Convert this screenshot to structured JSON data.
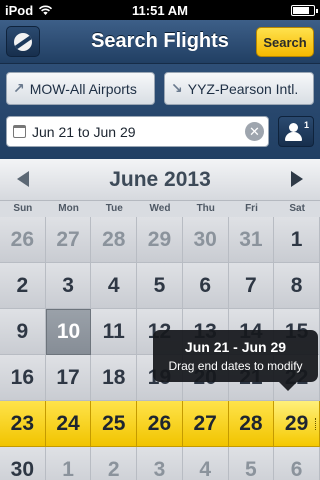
{
  "status_bar": {
    "carrier": "iPod",
    "time": "11:51 AM",
    "battery_level": 0.8
  },
  "header": {
    "title": "Search Flights",
    "search_label": "Search"
  },
  "search": {
    "from": "MOW-All Airports",
    "to": "YYZ-Pearson Intl.",
    "dates": "Jun 21 to Jun 29",
    "passengers": "1"
  },
  "calendar": {
    "month": "June 2013",
    "weekdays": [
      "Sun",
      "Mon",
      "Tue",
      "Wed",
      "Thu",
      "Fri",
      "Sat"
    ],
    "weeks": [
      [
        "26",
        "27",
        "28",
        "29",
        "30",
        "31",
        "1"
      ],
      [
        "2",
        "3",
        "4",
        "5",
        "6",
        "7",
        "8"
      ],
      [
        "9",
        "10",
        "11",
        "12",
        "13",
        "14",
        "15"
      ],
      [
        "16",
        "17",
        "18",
        "19",
        "20",
        "21",
        "22"
      ],
      [
        "23",
        "24",
        "25",
        "26",
        "27",
        "28",
        "29"
      ],
      [
        "30",
        "1",
        "2",
        "3",
        "4",
        "5",
        "6"
      ]
    ]
  },
  "tooltip": {
    "title": "Jun 21 - Jun 29",
    "text": "Drag end dates to modify"
  },
  "colors": {
    "header": "#2d4f78",
    "accent": "#f5c400",
    "today": "#8e959d"
  }
}
